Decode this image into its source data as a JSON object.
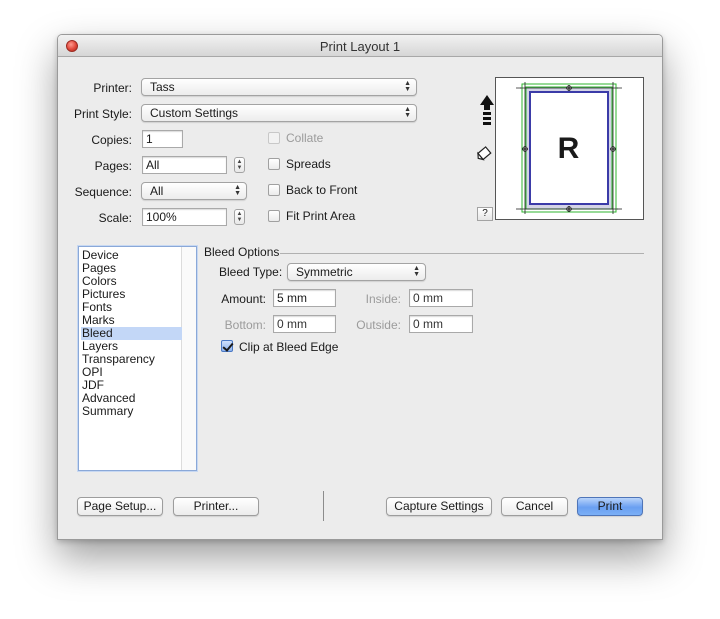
{
  "window": {
    "title": "Print Layout 1"
  },
  "printer": {
    "label": "Printer:",
    "value": "Tass"
  },
  "print_style": {
    "label": "Print Style:",
    "value": "Custom Settings"
  },
  "copies": {
    "label": "Copies:",
    "value": "1"
  },
  "pages": {
    "label": "Pages:",
    "value": "All"
  },
  "sequence": {
    "label": "Sequence:",
    "value": "All"
  },
  "scale": {
    "label": "Scale:",
    "value": "100%"
  },
  "options": {
    "collate": {
      "label": "Collate",
      "checked": false,
      "disabled": true
    },
    "spreads": {
      "label": "Spreads",
      "checked": false
    },
    "back_to_front": {
      "label": "Back to Front",
      "checked": false
    },
    "fit_print_area": {
      "label": "Fit Print Area",
      "checked": false
    }
  },
  "preview": {
    "page_letter": "R",
    "help_label": "?"
  },
  "sidebar": {
    "selected": "Bleed",
    "items": [
      "Device",
      "Pages",
      "Colors",
      "Pictures",
      "Fonts",
      "Marks",
      "Bleed",
      "Layers",
      "Transparency",
      "OPI",
      "JDF",
      "Advanced",
      "Summary"
    ]
  },
  "bleed": {
    "section_title": "Bleed Options",
    "type_label": "Bleed Type:",
    "type_value": "Symmetric",
    "amount_label": "Amount:",
    "amount_value": "5 mm",
    "inside_label": "Inside:",
    "inside_value": "0 mm",
    "bottom_label": "Bottom:",
    "bottom_value": "0 mm",
    "outside_label": "Outside:",
    "outside_value": "0 mm",
    "clip_label": "Clip at Bleed Edge",
    "clip_checked": true
  },
  "buttons": {
    "page_setup": "Page Setup...",
    "printer": "Printer...",
    "capture_settings": "Capture Settings",
    "cancel": "Cancel",
    "print": "Print"
  },
  "colors": {
    "accent": "#6a9ff1",
    "selection": "#c3d7f7",
    "page_border": "#4a4ab0",
    "bleed_guide": "#2fb52f"
  }
}
